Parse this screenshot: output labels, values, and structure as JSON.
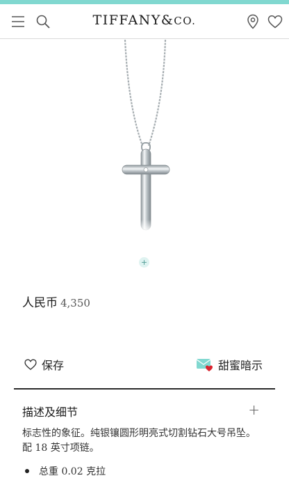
{
  "header": {
    "brand_main": "TIFFANY",
    "brand_amp": "&",
    "brand_co": "CO."
  },
  "product": {
    "currency_label": "人民币",
    "price": "4,350",
    "gallery_indicator": "+"
  },
  "actions": {
    "save_label": "保存",
    "hint_label": "甜蜜暗示"
  },
  "details": {
    "title": "描述及细节",
    "expand_symbol": "+",
    "line1": "标志性的象征。纯银镶圆形明亮式切割钻石大号吊坠。",
    "line2_prefix": "配 ",
    "line2_num": "18",
    "line2_suffix": " 英寸项链。",
    "bullet_prefix": "总重 ",
    "bullet_num": "0.02",
    "bullet_suffix": " 克拉"
  },
  "colors": {
    "accent": "#81d8d0"
  }
}
